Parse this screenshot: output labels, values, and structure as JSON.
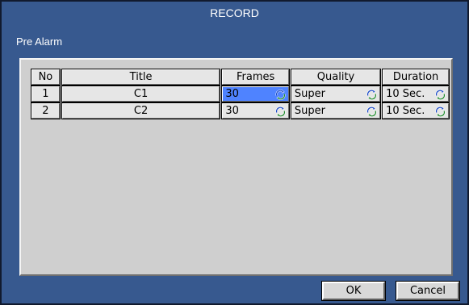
{
  "dialog": {
    "title": "RECORD",
    "section_label": "Pre Alarm"
  },
  "table": {
    "headers": [
      "No",
      "Title",
      "Frames",
      "Quality",
      "Duration"
    ],
    "rows": [
      {
        "no": "1",
        "title": "C1",
        "frames": "30",
        "quality": "Super",
        "duration": "10 Sec."
      },
      {
        "no": "2",
        "title": "C2",
        "frames": "30",
        "quality": "Super",
        "duration": "10 Sec."
      }
    ],
    "selected_cell": "row1-frames"
  },
  "buttons": {
    "ok": "OK",
    "cancel": "Cancel"
  },
  "colors": {
    "dialog_bg": "#37598f",
    "panel_bg": "#cfcfcf",
    "cell_bg": "#e6e6e6",
    "selected_bg": "#4f83ff"
  },
  "icons": {
    "spinner": "refresh-cycle-icon"
  }
}
